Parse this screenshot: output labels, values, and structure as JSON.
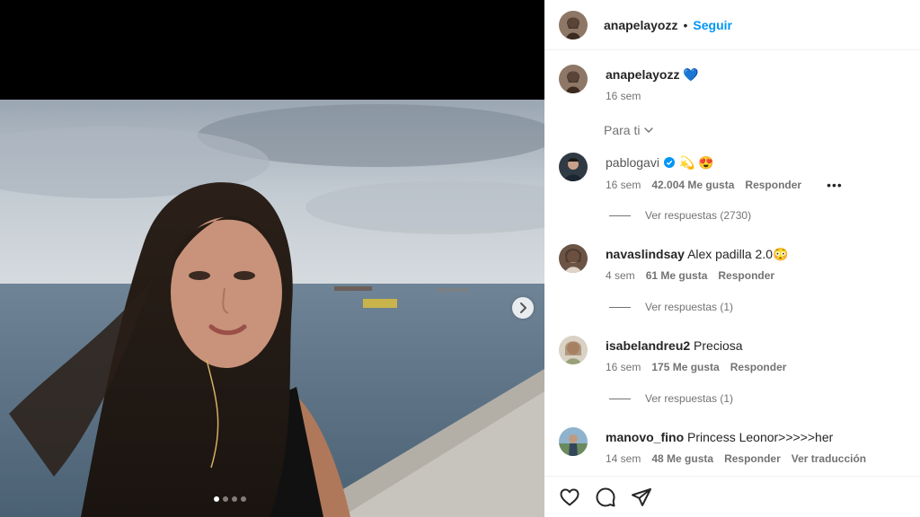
{
  "header": {
    "username": "anapelayozz",
    "separator": "•",
    "follow_label": "Seguir"
  },
  "caption": {
    "username": "anapelayozz",
    "badge": "💙",
    "time": "16 sem"
  },
  "sort": {
    "label": "Para ti",
    "icon": "chevron-down-icon"
  },
  "comments": [
    {
      "username": "pablogavi",
      "verified": true,
      "text": "💫 😍",
      "time": "16 sem",
      "likes": "42.004 Me gusta",
      "reply_label": "Responder",
      "more_label": "•••",
      "replies": "Ver respuestas (2730)"
    },
    {
      "username": "navaslindsay",
      "text": "Alex padilla 2.0😳",
      "time": "4 sem",
      "likes": "61 Me gusta",
      "reply_label": "Responder",
      "replies": "Ver respuestas (1)"
    },
    {
      "username": "isabelandreu2",
      "text": "Preciosa",
      "time": "16 sem",
      "likes": "175 Me gusta",
      "reply_label": "Responder",
      "replies": "Ver respuestas (1)"
    },
    {
      "username": "manovo_fino",
      "text": "Princess Leonor>>>>>her",
      "time": "14 sem",
      "likes": "48 Me gusta",
      "reply_label": "Responder",
      "translate_label": "Ver traducción"
    }
  ],
  "carousel": {
    "total": 4,
    "current": 1,
    "next_icon": "chevron-right-icon"
  },
  "actions": [
    "heart-icon",
    "comment-icon",
    "share-icon"
  ],
  "colors": {
    "accent": "#0095f6",
    "verified": "#0095f6",
    "text": "#262626",
    "secondary": "#737373"
  }
}
